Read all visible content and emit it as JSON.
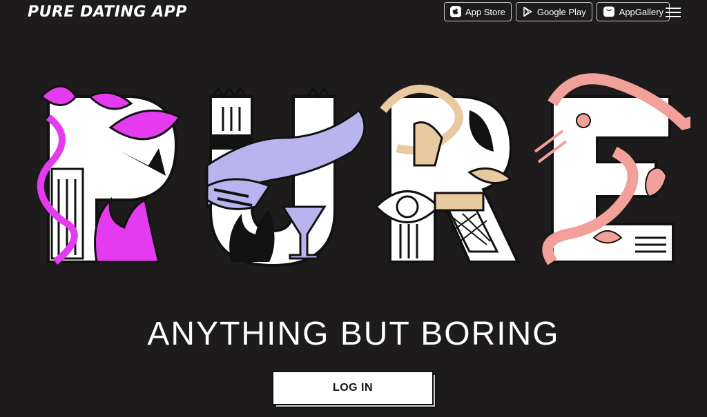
{
  "header": {
    "logo_text": "PURE DATING APP",
    "stores": [
      {
        "label": "App Store",
        "icon": "apple-icon"
      },
      {
        "label": "Google Play",
        "icon": "google-play-icon"
      },
      {
        "label": "AppGallery",
        "icon": "appgallery-icon"
      }
    ],
    "menu_icon": "hamburger-menu-icon"
  },
  "hero": {
    "letters": [
      "P",
      "U",
      "R",
      "E"
    ],
    "colors": {
      "magenta": "#e53bf0",
      "lavender": "#b9b4ee",
      "tan": "#e8c9a0",
      "pink": "#f2a09a",
      "ink": "#111111",
      "paper": "#ffffff"
    }
  },
  "tagline": "ANYTHING BUT BORING",
  "login_label": "LOG IN"
}
